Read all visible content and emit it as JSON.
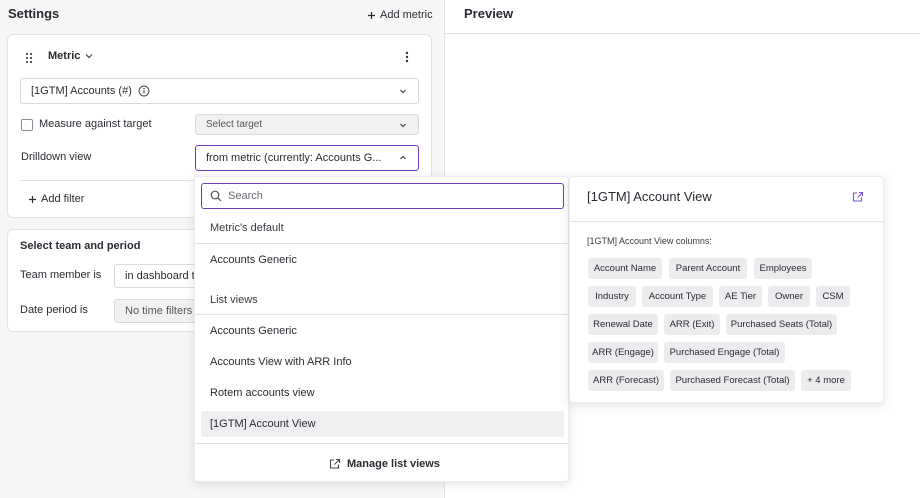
{
  "settings": {
    "title": "Settings",
    "add_metric": "Add metric",
    "metric_card": {
      "label": "Metric",
      "metric_value": "[1GTM] Accounts (#)",
      "measure_label": "Measure against target",
      "target_placeholder": "Select target",
      "drilldown_label": "Drilldown view",
      "drilldown_value": "from metric (currently: Accounts G...",
      "add_filter": "Add filter"
    },
    "team_card": {
      "title": "Select team and period",
      "team_label": "Team member is",
      "team_value": "in dashboard te",
      "date_label": "Date period is",
      "date_value": "No time filters"
    }
  },
  "preview": {
    "title": "Preview"
  },
  "dropdown": {
    "search_placeholder": "Search",
    "default_header": "Metric's default",
    "default_item": "Accounts Generic",
    "list_header": "List views",
    "items": [
      "Accounts Generic",
      "Accounts View with ARR Info",
      "Rotem accounts view",
      "[1GTM] Account View"
    ],
    "selected_index": 3,
    "manage": "Manage list views"
  },
  "popover": {
    "title": "[1GTM] Account View",
    "columns_label": "[1GTM] Account View columns:",
    "columns": [
      "Account Name",
      "Parent Account",
      "Employees",
      "Industry",
      "Account Type",
      "AE Tier",
      "Owner",
      "CSM",
      "Renewal Date",
      "ARR (Exit)",
      "Purchased Seats (Total)",
      "ARR (Engage)",
      "Purchased Engage (Total)",
      "ARR (Forecast)",
      "Purchased Forecast (Total)",
      "+ 4 more"
    ]
  },
  "colors": {
    "accent": "#6a3fbf",
    "link_icon": "#7a4fd0"
  }
}
